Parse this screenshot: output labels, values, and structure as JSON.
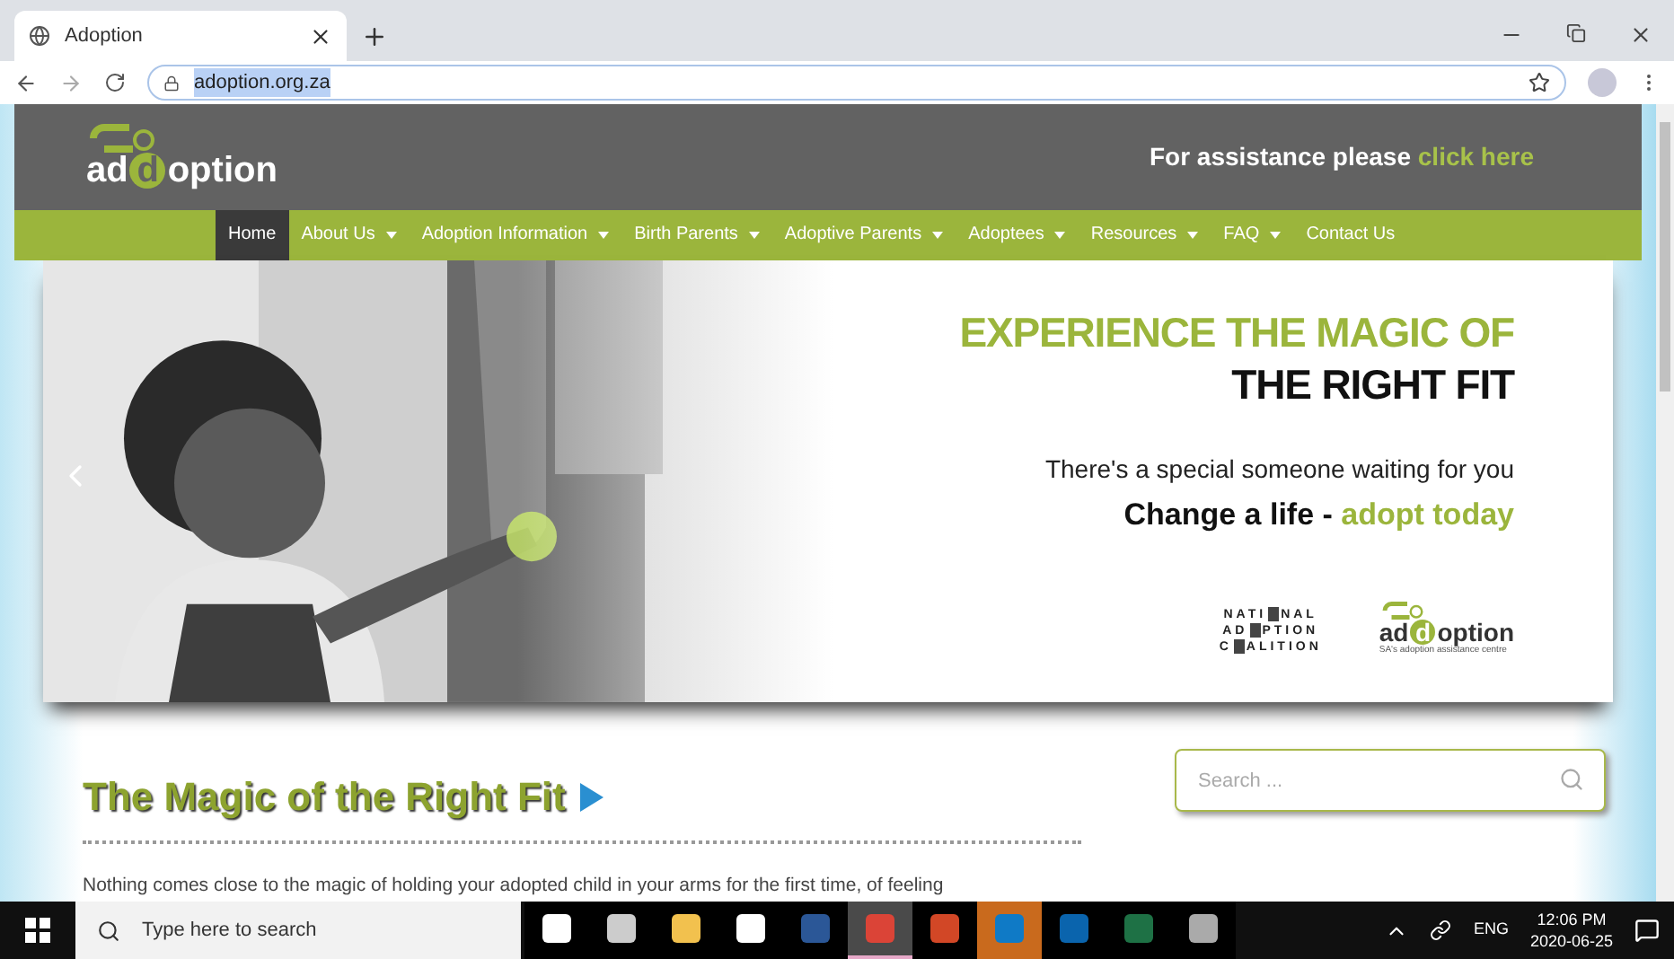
{
  "browser": {
    "tab": {
      "title": "Adoption"
    },
    "url": "adoption.org.za"
  },
  "header": {
    "logo": {
      "prefix": "ad",
      "mark": "d",
      "suffix": "option"
    },
    "assist": {
      "text": "For assistance please",
      "link": "click here"
    }
  },
  "nav": [
    {
      "label": "Home",
      "selected": true,
      "dropdown": false
    },
    {
      "label": "About Us",
      "selected": false,
      "dropdown": true
    },
    {
      "label": "Adoption Information",
      "selected": false,
      "dropdown": true
    },
    {
      "label": "Birth Parents",
      "selected": false,
      "dropdown": true
    },
    {
      "label": "Adoptive Parents",
      "selected": false,
      "dropdown": true
    },
    {
      "label": "Adoptees",
      "selected": false,
      "dropdown": true
    },
    {
      "label": "Resources",
      "selected": false,
      "dropdown": true
    },
    {
      "label": "FAQ",
      "selected": false,
      "dropdown": true
    },
    {
      "label": "Contact Us",
      "selected": false,
      "dropdown": false
    }
  ],
  "banner": {
    "headline_1": "EXPERIENCE THE MAGIC OF",
    "headline_2": "THE RIGHT FIT",
    "subline": "There's a special someone waiting for you",
    "cta_text": "Change a life -",
    "cta_highlight": "adopt today",
    "coalition_logo": [
      {
        "before": "NATI",
        "after": "NAL"
      },
      {
        "before": "AD",
        "after": "PTION"
      },
      {
        "before": "C",
        "after": "ALITION"
      }
    ],
    "logo": {
      "prefix": "ad",
      "mark": "d",
      "suffix": "option",
      "tagline": "SA's adoption assistance centre"
    }
  },
  "content": {
    "heading": "The Magic of the Right Fit",
    "paragraph": "Nothing comes close to the magic of holding your adopted child in your arms for the first time, of feeling"
  },
  "search": {
    "placeholder": "Search ..."
  },
  "taskbar": {
    "search_placeholder": "Type here to search",
    "apps": [
      {
        "kind": "taskview",
        "selected": false
      },
      {
        "kind": "people",
        "selected": false
      },
      {
        "kind": "explorer",
        "selected": false
      },
      {
        "kind": "store",
        "selected": false
      },
      {
        "kind": "word",
        "selected": false
      },
      {
        "kind": "chrome",
        "selected": true
      },
      {
        "kind": "powerpoint",
        "selected": false
      },
      {
        "kind": "edge",
        "selected": false
      },
      {
        "kind": "outlook",
        "selected": false
      },
      {
        "kind": "excel",
        "selected": false
      },
      {
        "kind": "paint",
        "selected": false
      }
    ],
    "language": "ENG",
    "time": "12:06 PM",
    "date": "2020-06-25"
  }
}
